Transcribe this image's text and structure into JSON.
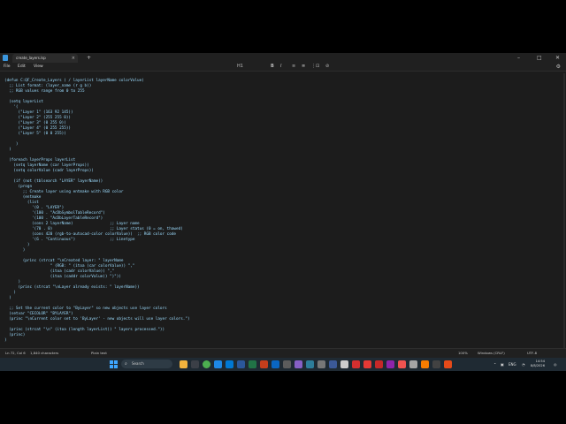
{
  "tab": {
    "title": "create_layers.lsp",
    "close": "×"
  },
  "newtab": "+",
  "window_controls": {
    "minimize": "–",
    "maximize": "□",
    "close": "✕"
  },
  "menu": {
    "file": "File",
    "edit": "Edit",
    "view": "View"
  },
  "toolbar": {
    "heading": "H1",
    "bold": "B",
    "italic": "I",
    "format_icons": [
      "≡",
      "≣",
      "⋮",
      "⊡",
      "⊘"
    ]
  },
  "code": "(defun C:QF_Create_Layers ( / layerList layerName colorValue)\n  ;; List format: (layer_name (r g b))\n  ;; RGB values range from 0 to 255\n\n  (setq layerList\n    '(\n      (\"Layer 1\" (163 92 145))\n      (\"Layer 2\" (255 255 0))\n      (\"Layer 3\" (0 255 0))\n      (\"Layer 4\" (0 255 255))\n      (\"Layer 5\" (0 0 255))\n\n     )\n  )\n\n  (foreach layerProps layerList\n    (setq layerName (car layerProps))\n    (setq colorValue (cadr layerProps))\n\n    (if (not (tblsearch \"LAYER\" layerName))\n      (progn\n        ;; Create layer using entmake with RGB color\n        (entmake\n          (list\n            '(0 . \"LAYER\")\n            '(100 . \"AcDbSymbolTableRecord\")\n            '(100 . \"AcDbLayerTableRecord\")\n            (cons 2 layerName)                ;; Layer name\n            '(70 . 0)                         ;; Layer status (0 = on, thawed)\n            (cons 420 (rgb-to-autocad-color colorValue))  ;; RGB color code\n            '(6 . \"Continuous\")               ;; Linetype\n          )\n        )\n\n        (princ (strcat \"\\nCreated layer: \" layerName\n                    \" (RGB: \" (itoa (car colorValue)) \",\"\n                    (itoa (cadr colorValue)) \",\"\n                    (itoa (caddr colorValue)) \")\"))\n      )\n      (princ (strcat \"\\nLayer already exists: \" layerName))\n    )\n  )\n\n  ;; Set the current color to \"ByLayer\" so new objects use layer colors\n  (setvar \"CECOLOR\" \"BYLAYER\")\n  (princ \"\\nCurrent color set to 'ByLayer' - new objects will use layer colors.\")\n\n  (princ (strcat \"\\n\" (itoa (length layerList)) \" layers processed.\"))\n  (princ)\n)",
  "status": {
    "position": "Ln 72, Col 6",
    "chars": "1,840 characters",
    "format": "Plain text",
    "zoom": "100%",
    "line_ending": "Windows (CRLF)",
    "encoding": "UTF-8"
  },
  "taskbar": {
    "search_placeholder": "Search",
    "language": "ENG",
    "time": "14:54",
    "date": "8/8/2026"
  },
  "colors": {
    "editor_bg": "#1c1c1c",
    "code_text": "#9cdcfe",
    "taskbar_bg": "#1f2a33",
    "accent": "#3ea6ff"
  }
}
